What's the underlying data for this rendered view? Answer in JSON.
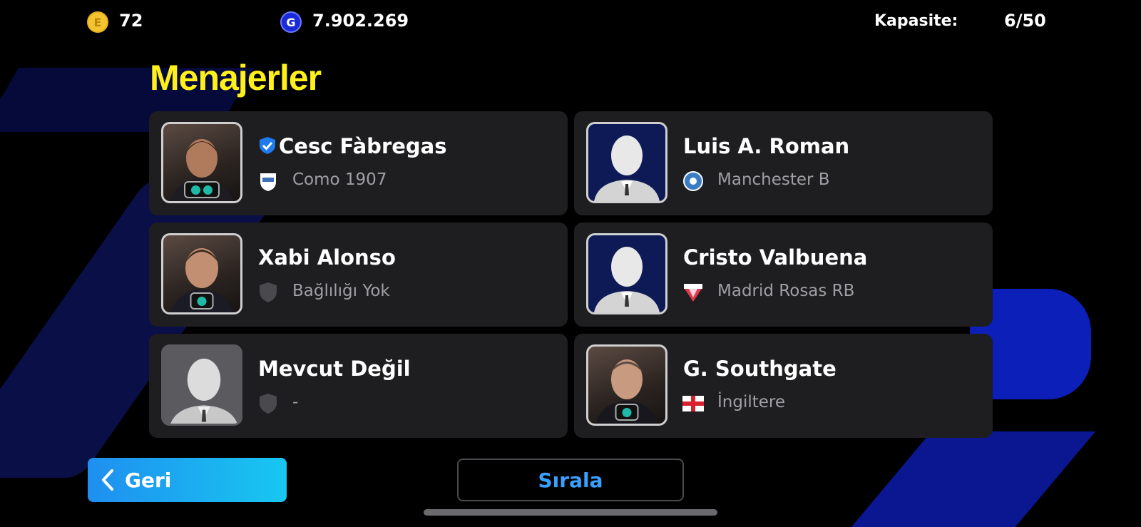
{
  "currency": {
    "coins_value": "72",
    "gp_value": "7.902.269",
    "coin_icon": "efootball-coin-icon",
    "gp_icon": "gp-icon",
    "coin_letter": "E",
    "gp_letter": "G"
  },
  "capacity": {
    "label": "Kapasite:",
    "value": "6/50"
  },
  "page_title": "Menajerler",
  "managers": [
    {
      "name": "Cesc Fàbregas",
      "club": "Como 1907",
      "verified": true,
      "portrait": "photo",
      "badges": 2
    },
    {
      "name": "Luis A. Roman",
      "club": "Manchester B",
      "verified": false,
      "portrait": "silhouette-navy",
      "badges": 0
    },
    {
      "name": "Xabi Alonso",
      "club": "Bağlılığı Yok",
      "verified": false,
      "portrait": "photo",
      "badges": 1
    },
    {
      "name": "Cristo Valbuena",
      "club": "Madrid Rosas RB",
      "verified": false,
      "portrait": "silhouette-navy",
      "badges": 0
    },
    {
      "name": "Mevcut Değil",
      "club": "-",
      "verified": false,
      "portrait": "silhouette-grey",
      "badges": 0
    },
    {
      "name": "G. Southgate",
      "club": "İngiltere",
      "verified": false,
      "portrait": "photo",
      "badges": 1
    }
  ],
  "buttons": {
    "back_label": "Geri",
    "sort_label": "Sırala"
  },
  "colors": {
    "title_yellow": "#ffef1a",
    "back_button_start": "#1f8ff0",
    "back_button_end": "#18c7f0",
    "sort_text_blue": "#3aa0ff",
    "card_bg": "#1e1e20"
  }
}
